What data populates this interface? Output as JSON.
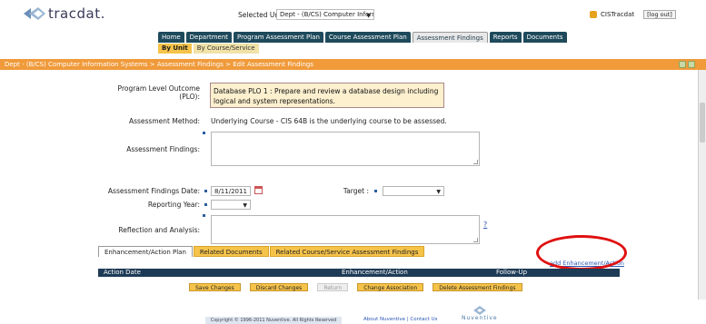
{
  "header": {
    "logo_text": "tracdat.",
    "selected_unit_label": "Selected Unit:",
    "selected_unit_value": "Dept - (B/CS) Computer Information Systems",
    "user_name": "CISTracdat",
    "logout_label": "[log out]"
  },
  "nav": {
    "tabs": [
      {
        "label": "Home"
      },
      {
        "label": "Department"
      },
      {
        "label": "Program Assessment Plan"
      },
      {
        "label": "Course Assessment Plan"
      },
      {
        "label": "Assessment Findings"
      },
      {
        "label": "Reports"
      },
      {
        "label": "Documents"
      }
    ],
    "subtabs": [
      {
        "label": "By Unit"
      },
      {
        "label": "By Course/Service"
      }
    ]
  },
  "breadcrumb": "Dept - (B/CS) Computer Information Systems > Assessment Findings > Edit Assessment Findings",
  "form": {
    "plo_label": "Program Level Outcome (PLO):",
    "plo_value": "Database PLO 1 : Prepare and review a database design including logical and system representations.",
    "method_label": "Assessment Method:",
    "method_value": "Underlying Course - CIS 64B is the underlying course to be assessed.",
    "findings_label": "Assessment Findings:",
    "findings_value": "",
    "date_label": "Assessment Findings Date:",
    "date_value": "8/11/2011",
    "target_label": "Target :",
    "target_value": "",
    "reporting_year_label": "Reporting Year:",
    "reporting_year_value": "",
    "reflection_label": "Reflection and Analysis:",
    "reflection_value": "",
    "help_label": "?"
  },
  "lower_tabs": [
    {
      "label": "Enhancement/Action Plan"
    },
    {
      "label": "Related Documents"
    },
    {
      "label": "Related Course/Service Assessment Findings"
    }
  ],
  "add_link": "add Enhancement/Action",
  "table": {
    "columns": [
      "Action Date",
      "Enhancement/Action",
      "Follow-Up"
    ]
  },
  "buttons": [
    {
      "label": "Save Changes"
    },
    {
      "label": "Discard Changes"
    },
    {
      "label": "Return"
    },
    {
      "label": "Change Association"
    },
    {
      "label": "Delete Assessment Findings"
    }
  ],
  "footer": {
    "copyright": "Copyright © 1996-2011 Nuventive. All Rights Reserved",
    "about_link": "About Nuventive",
    "separator": "|",
    "contact_link": "Contact Us",
    "logo_text": "Nuventive"
  },
  "colors": {
    "nav_tab": "#1e4a5c",
    "breadcrumb_bar": "#f09a3a",
    "subtab_active": "#f6c34a",
    "table_header": "#1e3b56",
    "annotation_circle": "#e01010"
  }
}
